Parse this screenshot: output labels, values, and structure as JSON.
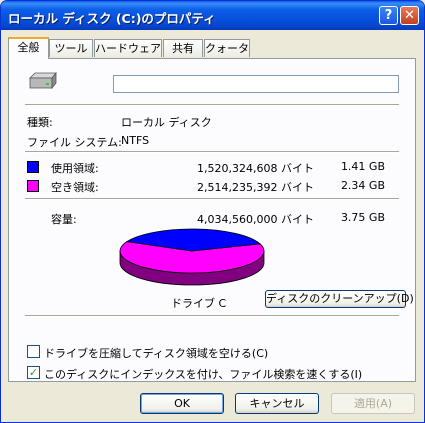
{
  "window": {
    "title": "ローカル ディスク (C:)のプロパティ",
    "help_label": "?",
    "close_label": "✕"
  },
  "tabs": [
    "全般",
    "ツール",
    "ハードウェア",
    "共有",
    "クォータ"
  ],
  "general": {
    "volume_name": "",
    "type_label": "種類:",
    "type_value": "ローカル ディスク",
    "fs_label": "ファイル システム:",
    "fs_value": "NTFS",
    "used_label": "使用領域:",
    "used_bytes": "1,520,324,608 バイト",
    "used_gb": "1.41 GB",
    "free_label": "空き領域:",
    "free_bytes": "2,514,235,392 バイト",
    "free_gb": "2.34 GB",
    "capacity_label": "容量:",
    "capacity_bytes": "4,034,560,000 バイト",
    "capacity_gb": "3.75 GB",
    "drive_label": "ドライブ C",
    "cleanup_label": "ディスクのクリーンアップ(D)",
    "compress_label": "ドライブを圧縮してディスク領域を空ける(C)",
    "compress_checked": false,
    "index_label": "このディスクにインデックスを付け、ファイル検索を速くする(I)",
    "index_checked": true
  },
  "chart_data": {
    "type": "pie",
    "labels": [
      "使用領域",
      "空き領域"
    ],
    "values": [
      1520324608,
      2514235392
    ],
    "colors": [
      "#0000ff",
      "#ff00ff"
    ]
  },
  "colors": {
    "used": "#0000ff",
    "free": "#ff00ff",
    "used_side": "#000080",
    "free_side": "#800080"
  },
  "buttons": {
    "ok": "OK",
    "cancel": "キャンセル",
    "apply": "適用(A)"
  }
}
